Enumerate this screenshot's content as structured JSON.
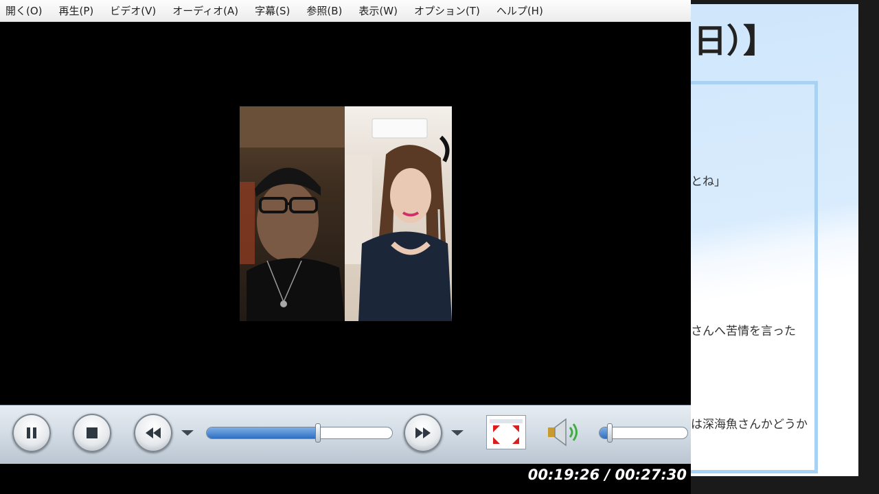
{
  "menu": {
    "items": [
      "開く(O)",
      "再生(P)",
      "ビデオ(V)",
      "オーディオ(A)",
      "字幕(S)",
      "参照(B)",
      "表示(W)",
      "オプション(T)",
      "ヘルプ(H)"
    ]
  },
  "player": {
    "seek_progress": 0.6,
    "volume_level": 0.12,
    "time": {
      "current": "00:19:26",
      "separator": "/",
      "total": "00:27:30"
    }
  },
  "background_doc": {
    "heading": "日）】",
    "lines": [
      "とね」",
      "さんへ苦情を言った",
      "は深海魚さんかどうか"
    ]
  },
  "colors": {
    "menubar": "#f2f2f2",
    "controls_bar": "#cfd8e1",
    "slider_fill": "#2e6fc2",
    "fullscreen_arrows": "#d81e1e",
    "volume_wave": "#3fae3f"
  },
  "icons": {
    "pause": "pause-icon",
    "stop": "stop-icon",
    "rewind": "rewind-icon",
    "fast_forward": "fast-forward-icon",
    "fullscreen": "fullscreen-icon",
    "volume": "speaker-icon"
  }
}
